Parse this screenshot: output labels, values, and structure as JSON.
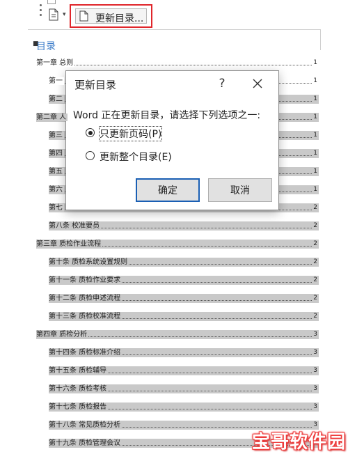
{
  "toolbar": {
    "update_toc_label": "更新目录..."
  },
  "document": {
    "toc_heading": "目录",
    "entries": [
      {
        "level": 1,
        "text": "第一章  总则",
        "page": "1",
        "shaded": false
      },
      {
        "level": 2,
        "text": "第一",
        "page": "1",
        "shaded": false
      },
      {
        "level": 2,
        "text": "第二",
        "page": "1",
        "shaded": true
      },
      {
        "level": 1,
        "text": "第二章  人",
        "page": "1",
        "shaded": true
      },
      {
        "level": 2,
        "text": "第三",
        "page": "1",
        "shaded": true
      },
      {
        "level": 2,
        "text": "第四",
        "page": "1",
        "shaded": true
      },
      {
        "level": 2,
        "text": "第五",
        "page": "1",
        "shaded": true
      },
      {
        "level": 2,
        "text": "第六",
        "page": "1",
        "shaded": true
      },
      {
        "level": 2,
        "text": "第七",
        "page": "2",
        "shaded": true
      },
      {
        "level": 2,
        "text": "第八条  校准要员",
        "page": "2",
        "shaded": true
      },
      {
        "level": 1,
        "text": "第三章  质检作业流程",
        "page": "2",
        "shaded": true
      },
      {
        "level": 2,
        "text": "第十条  质检系统设置规则",
        "page": "2",
        "shaded": true
      },
      {
        "level": 2,
        "text": "第十一条  质检作业要求",
        "page": "2",
        "shaded": true
      },
      {
        "level": 2,
        "text": "第十二条  质检申述流程",
        "page": "2",
        "shaded": true
      },
      {
        "level": 2,
        "text": "第十三条  质检校准流程",
        "page": "2",
        "shaded": true
      },
      {
        "level": 1,
        "text": "第四章  质检分析",
        "page": "3",
        "shaded": true
      },
      {
        "level": 2,
        "text": "第十四条  质检标准介绍",
        "page": "3",
        "shaded": true
      },
      {
        "level": 2,
        "text": "第十五条  质检辅导",
        "page": "3",
        "shaded": true
      },
      {
        "level": 2,
        "text": "第十六条  质检考核",
        "page": "3",
        "shaded": true
      },
      {
        "level": 2,
        "text": "第十七条  质检报告",
        "page": "3",
        "shaded": true
      },
      {
        "level": 2,
        "text": "第十八条  常见质检分析",
        "page": "3",
        "shaded": true
      },
      {
        "level": 2,
        "text": "第十九条  质检管理会议",
        "page": "3",
        "shaded": true
      }
    ]
  },
  "dialog": {
    "title": "更新目录",
    "help": "?",
    "prompt": "Word 正在更新目录，请选择下列选项之一:",
    "options": [
      {
        "label": "只更新页码(P)",
        "selected": true
      },
      {
        "label": "更新整个目录(E)",
        "selected": false
      }
    ],
    "ok_label": "确定",
    "cancel_label": "取消"
  },
  "watermark": {
    "text": "宝哥软件园"
  },
  "colors": {
    "highlight_red": "#e0262b",
    "toc_shading": "#c9c9c9",
    "default_button_border": "#1a5fb4",
    "heading_blue": "#3a7bc8"
  }
}
